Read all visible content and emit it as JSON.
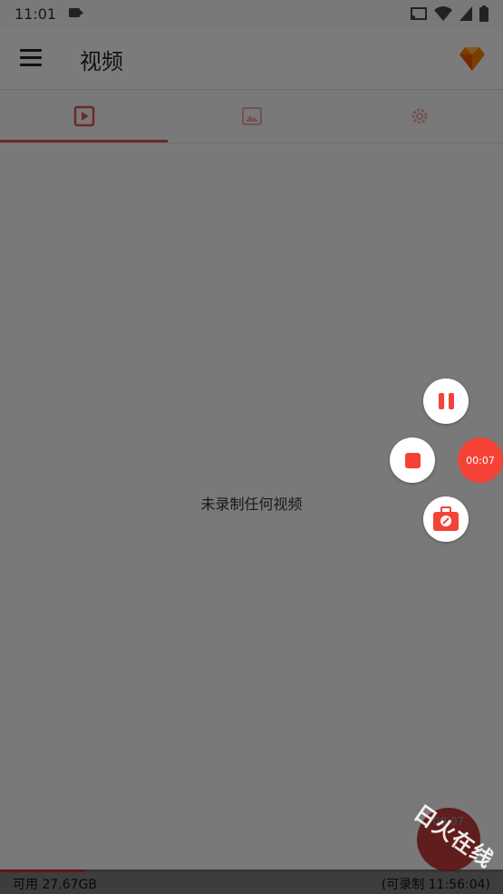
{
  "status": {
    "time": "11:01"
  },
  "app": {
    "title": "视频"
  },
  "tabs": [
    {
      "name": "video-tab",
      "icon": "play-box-icon"
    },
    {
      "name": "image-tab",
      "icon": "image-icon"
    },
    {
      "name": "settings-tab",
      "icon": "gear-icon"
    }
  ],
  "content": {
    "empty_message": "未录制任何视频"
  },
  "controls": {
    "timer": "00:07"
  },
  "storage": {
    "available": "可用 27.67GB",
    "remaining": "(可录制 11:56:04)",
    "used_fraction": 0.17
  },
  "bottom_fab": {
    "timer": "00:07"
  },
  "watermark": "日火在线",
  "colors": {
    "accent": "#f44336",
    "indicator": "#d9534f"
  }
}
